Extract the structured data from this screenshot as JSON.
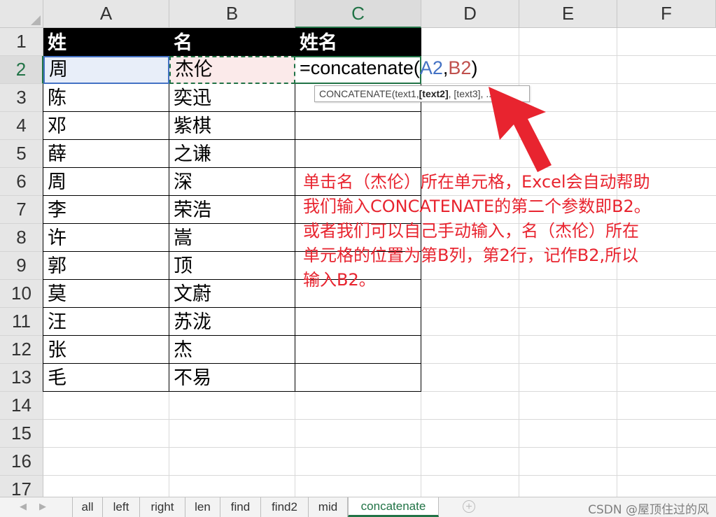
{
  "columns": [
    "A",
    "B",
    "C",
    "D",
    "E",
    "F"
  ],
  "active_column": "C",
  "rows": [
    "1",
    "2",
    "3",
    "4",
    "5",
    "6",
    "7",
    "8",
    "9",
    "10",
    "11",
    "12",
    "13",
    "14",
    "15",
    "16",
    "17"
  ],
  "active_row": "2",
  "header_row": {
    "a": "姓",
    "b": "名",
    "c": "姓名"
  },
  "data_rows": [
    {
      "a": "周",
      "b": "杰伦"
    },
    {
      "a": "陈",
      "b": "奕迅"
    },
    {
      "a": "邓",
      "b": "紫棋"
    },
    {
      "a": "薛",
      "b": "之谦"
    },
    {
      "a": "周",
      "b": "深"
    },
    {
      "a": "李",
      "b": "荣浩"
    },
    {
      "a": "许",
      "b": "嵩"
    },
    {
      "a": "郭",
      "b": "顶"
    },
    {
      "a": "莫",
      "b": "文蔚"
    },
    {
      "a": "汪",
      "b": "苏泷"
    },
    {
      "a": "张",
      "b": "杰"
    },
    {
      "a": "毛",
      "b": "不易"
    }
  ],
  "formula": {
    "prefix": "=concatenate(",
    "ref1": "A2",
    "sep": ",",
    "ref2": "B2",
    "suffix": ")"
  },
  "tooltip": {
    "func": "CONCATENATE(text1, ",
    "arg2": "[text2]",
    "rest": ", [text3], ...)"
  },
  "annotation": [
    "单击名（杰伦）所在单元格，Excel会自动帮助",
    "我们输入CONCATENATE的第二个参数即B2。",
    "或者我们可以自己手动输入，名（杰伦）所在",
    "单元格的位置为第B列，第2行，记作B2,所以",
    "输入B2。"
  ],
  "tabs": [
    "all",
    "left",
    "right",
    "len",
    "find",
    "find2",
    "mid",
    "concatenate"
  ],
  "active_tab": "concatenate",
  "watermark": "CSDN @屋顶住过的风",
  "colors": {
    "accent": "#217346",
    "annotation": "#e8242f",
    "ref_a": "#4472c4",
    "ref_b": "#c0504d"
  }
}
